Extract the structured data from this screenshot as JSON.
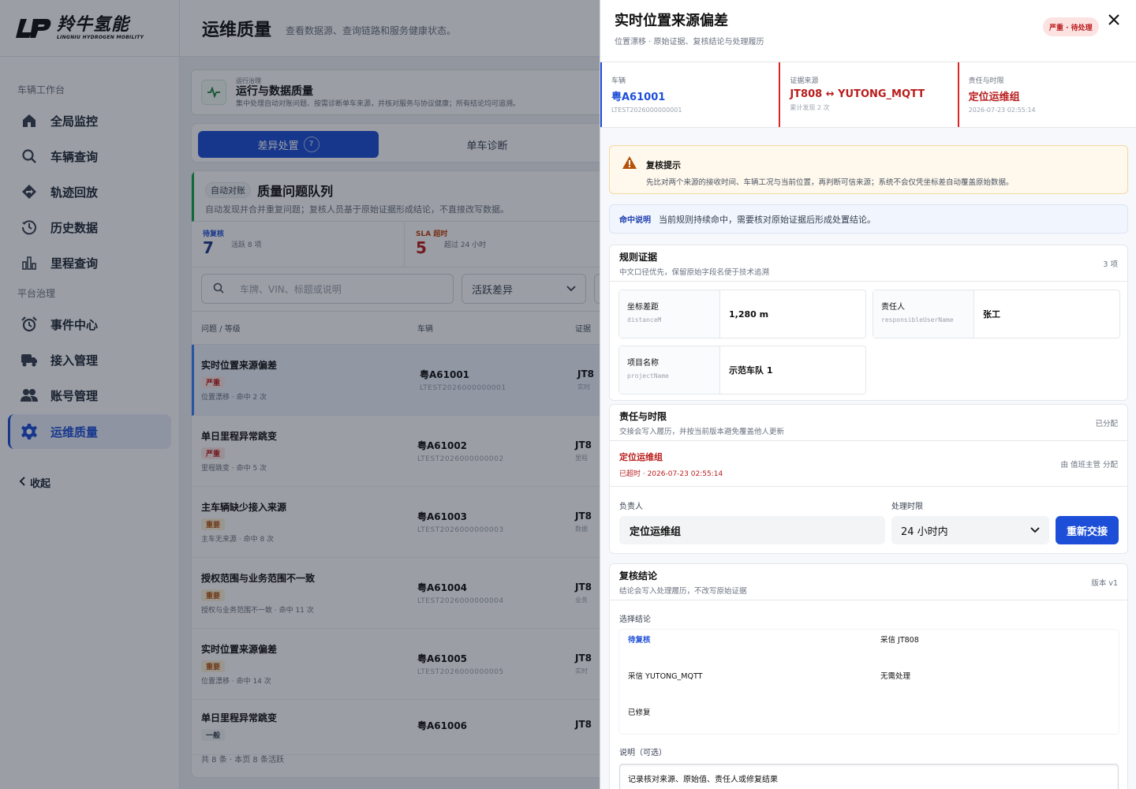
{
  "brand": {
    "name_cn": "羚牛氢能",
    "name_en": "LINGNIU HYDROGEN MOBILITY"
  },
  "sidebar": {
    "groups": [
      {
        "label": "车辆工作台"
      },
      {
        "label": "平台治理"
      }
    ],
    "items": [
      {
        "label": "全局监控",
        "icon": "home-icon"
      },
      {
        "label": "车辆查询",
        "icon": "search-icon"
      },
      {
        "label": "轨迹回放",
        "icon": "route-icon"
      },
      {
        "label": "历史数据",
        "icon": "history-icon"
      },
      {
        "label": "里程查询",
        "icon": "bar-chart-icon"
      },
      {
        "label": "事件中心",
        "icon": "alarm-clock-icon"
      },
      {
        "label": "接入管理",
        "icon": "truck-icon"
      },
      {
        "label": "账号管理",
        "icon": "users-icon"
      },
      {
        "label": "运维质量",
        "icon": "gear-icon",
        "active": true
      }
    ],
    "collapse_label": "收起"
  },
  "page": {
    "title": "运维质量",
    "desc": "查看数据源、查询链路和服务健康状态。"
  },
  "banner": {
    "kicker": "运行治理",
    "title": "运行与数据质量",
    "sub": "集中处理自动对账问题、按需诊断单车来源，并核对服务与协议健康；所有结论均可追溯。"
  },
  "tabs": [
    {
      "label": "差异处置",
      "count": "7",
      "active": true
    },
    {
      "label": "单车诊断"
    }
  ],
  "queue": {
    "tag": "自动对账",
    "title": "质量问题队列",
    "sub": "自动发现并合并重复问题；复核人员基于原始证据形成结论，不直接改写数据。",
    "stats": [
      {
        "label": "待复核",
        "value": "7",
        "note": "活跃 8 项"
      },
      {
        "label": "SLA 超时",
        "value": "5",
        "note": "超过 24 小时"
      }
    ],
    "search_placeholder": "车牌、VIN、标题或说明",
    "filter_value": "活跃差异",
    "columns": [
      "问题 / 等级",
      "车辆",
      "证据"
    ],
    "rows": [
      {
        "title": "实时位置来源偏差",
        "level": "严重",
        "level_type": "crit",
        "sub": "位置漂移 · 命中 2 次",
        "plate": "粤A61001",
        "vin": "LTEST2026000000001",
        "evidence": "JT8",
        "evidence_sub": "实时",
        "selected": true
      },
      {
        "title": "单日里程异常跳变",
        "level": "严重",
        "level_type": "crit",
        "sub": "里程跳变 · 命中 5 次",
        "plate": "粤A61002",
        "vin": "LTEST2026000000002",
        "evidence": "JT8",
        "evidence_sub": "里程"
      },
      {
        "title": "主车辆缺少接入来源",
        "level": "重要",
        "level_type": "high",
        "sub": "主车无来源 · 命中 8 次",
        "plate": "粤A61003",
        "vin": "LTEST2026000000003",
        "evidence": "JT8",
        "evidence_sub": "数据"
      },
      {
        "title": "授权范围与业务范围不一致",
        "level": "重要",
        "level_type": "high",
        "sub": "授权与业务范围不一致 · 命中 11 次",
        "plate": "粤A61004",
        "vin": "LTEST2026000000004",
        "evidence": "JT8",
        "evidence_sub": "业务"
      },
      {
        "title": "实时位置来源偏差",
        "level": "重要",
        "level_type": "high",
        "sub": "位置漂移 · 命中 14 次",
        "plate": "粤A61005",
        "vin": "LTEST2026000000005",
        "evidence": "JT8",
        "evidence_sub": "实时"
      },
      {
        "title": "单日里程异常跳变",
        "level": "一般",
        "level_type": "norm",
        "sub": "",
        "plate": "粤A61006",
        "vin": "",
        "evidence": "JT8",
        "evidence_sub": ""
      }
    ],
    "footer": "共 8 条 · 本页 8 条活跃"
  },
  "drawer": {
    "title": "实时位置来源偏差",
    "sub": "位置漂移 · 原始证据、复核结论与处理履历",
    "severity": "严重 · 待处理",
    "summary": [
      {
        "label": "车辆",
        "value": "粤A61001",
        "note": "LTEST2026000000001"
      },
      {
        "label": "证据来源",
        "value": "JT808 ↔ YUTONG_MQTT",
        "note": "累计发现 2 次"
      },
      {
        "label": "责任与时限",
        "value": "定位运维组",
        "note": "2026-07-23 02:55:14"
      }
    ],
    "warning": {
      "title": "复核提示",
      "text": "先比对两个来源的接收时间、车辆工况与当前位置，再判断可信来源；系统不会仅凭坐标差自动覆盖原始数据。"
    },
    "hit": {
      "tag": "命中说明",
      "text": "当前规则持续命中，需要核对原始证据后形成处置结论。"
    },
    "evidence": {
      "title": "规则证据",
      "sub": "中文口径优先，保留原始字段名便于技术追溯",
      "count": "3 项",
      "items": [
        {
          "label": "坐标差距",
          "field": "distanceM",
          "value": "1,280 m"
        },
        {
          "label": "责任人",
          "field": "responsibleUserName",
          "value": "张工"
        },
        {
          "label": "项目名称",
          "field": "projectName",
          "value": "示范车队 1"
        }
      ]
    },
    "responsibility": {
      "title": "责任与时限",
      "sub": "交接会写入履历，并按当前版本避免覆盖他人更新",
      "status": "已分配",
      "owner": "定位运维组",
      "due": "已超时 · 2026-07-23 02:55:14",
      "assigned_by": "由 值班主管 分配",
      "assignee_label": "负责人",
      "assignee_value": "定位运维组",
      "deadline_label": "处理时限",
      "deadline_value": "24 小时内",
      "button": "重新交接"
    },
    "conclusion": {
      "title": "复核结论",
      "sub": "结论会写入处理履历，不改写原始证据",
      "version": "版本 v1",
      "choose_label": "选择结论",
      "options": [
        "待复核",
        "采信 JT808",
        "采信 YUTONG_MQTT",
        "无需处理",
        "已修复"
      ],
      "note_label": "说明（可选）",
      "note_value": "记录核对来源、原始值、责任人或修复结果"
    }
  }
}
